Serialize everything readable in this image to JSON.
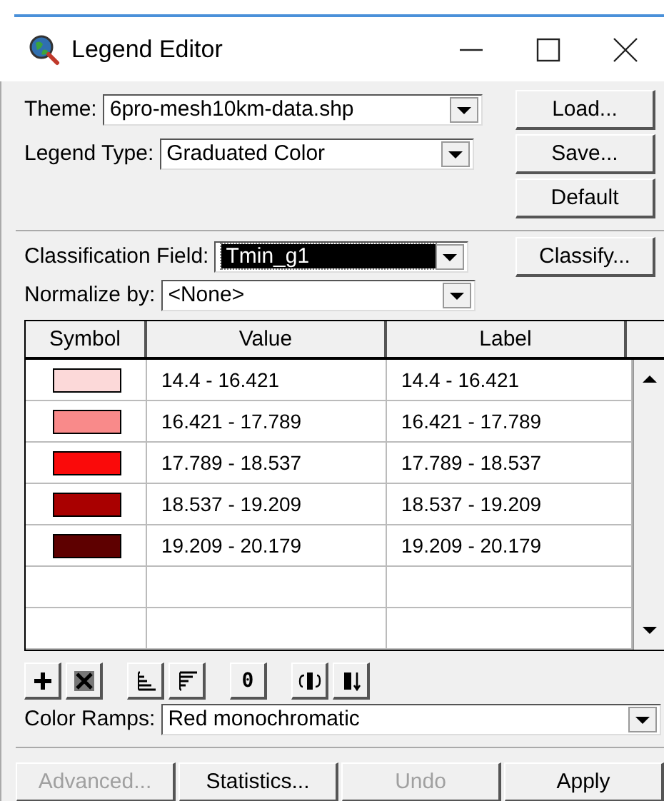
{
  "window": {
    "title": "Legend Editor"
  },
  "theme": {
    "label": "Theme:",
    "value": "6pro-mesh10km-data.shp"
  },
  "legend_type": {
    "label": "Legend Type:",
    "value": "Graduated Color"
  },
  "side_buttons": [
    {
      "label": "Load..."
    },
    {
      "label": "Save..."
    },
    {
      "label": "Default"
    }
  ],
  "classification_field": {
    "label": "Classification Field:",
    "value": "Tmin_g1",
    "focused": true
  },
  "classify_button": {
    "label": "Classify..."
  },
  "normalize": {
    "label": "Normalize by:",
    "value": "<None>"
  },
  "table": {
    "columns": [
      "Symbol",
      "Value",
      "Label"
    ],
    "rows": [
      {
        "color": "#fcd9d9",
        "value": "14.4 - 16.421",
        "label": "14.4 - 16.421"
      },
      {
        "color": "#f98a8a",
        "value": "16.421 - 17.789",
        "label": "16.421 - 17.789"
      },
      {
        "color": "#fa0a0a",
        "value": "17.789 - 18.537",
        "label": "17.789 - 18.537"
      },
      {
        "color": "#a90000",
        "value": "18.537 - 19.209",
        "label": "18.537 - 19.209"
      },
      {
        "color": "#5e0000",
        "value": "19.209 - 20.179",
        "label": "19.209 - 20.179"
      }
    ]
  },
  "toolbar": [
    {
      "kind": "add"
    },
    {
      "kind": "delete"
    },
    {
      "kind": "ascending"
    },
    {
      "kind": "descending"
    },
    {
      "kind": "text",
      "label": "0"
    },
    {
      "kind": "flip"
    },
    {
      "kind": "sort"
    }
  ],
  "color_ramps": {
    "label": "Color Ramps:",
    "value": "Red monochromatic"
  },
  "bottom_buttons": [
    {
      "label": "Advanced...",
      "disabled": true
    },
    {
      "label": "Statistics...",
      "disabled": false
    },
    {
      "label": "Undo",
      "disabled": true
    },
    {
      "label": "Apply",
      "disabled": false
    }
  ]
}
